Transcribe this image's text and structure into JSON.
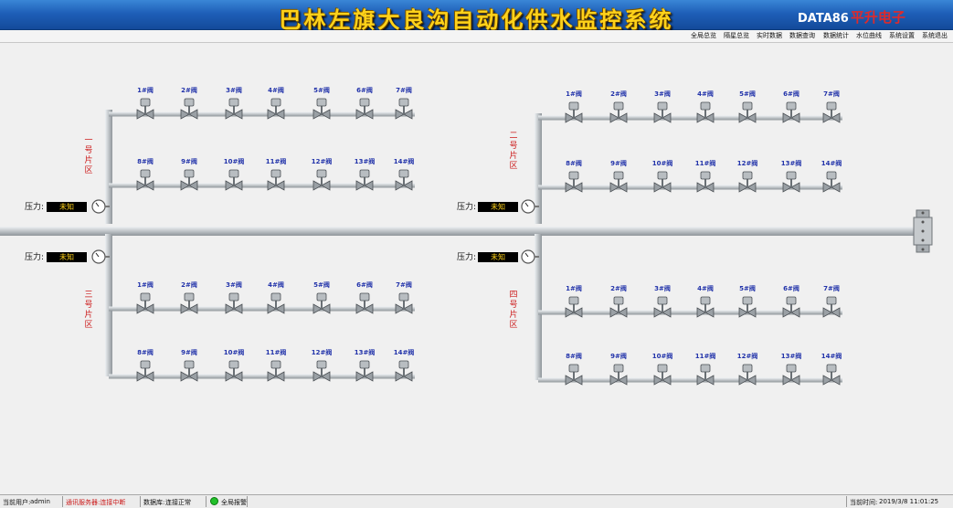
{
  "app": {
    "title": "巴林左旗大良沟自动化供水监控系统",
    "brand_primary": "DATA86",
    "brand_secondary": "平升电子"
  },
  "menu": [
    {
      "label": "全局总览"
    },
    {
      "label": "隔星总览"
    },
    {
      "label": "实时数据"
    },
    {
      "label": "数据查询"
    },
    {
      "label": "数据统计"
    },
    {
      "label": "水位曲线"
    },
    {
      "label": "系统设置"
    },
    {
      "label": "系统退出"
    }
  ],
  "zones": [
    {
      "label": "一号片区",
      "pressure_label": "压力:",
      "pressure_value": "未知",
      "row1": [
        "1#阀",
        "2#阀",
        "3#阀",
        "4#阀",
        "5#阀",
        "6#阀",
        "7#阀"
      ],
      "row2": [
        "8#阀",
        "9#阀",
        "10#阀",
        "11#阀",
        "12#阀",
        "13#阀",
        "14#阀"
      ]
    },
    {
      "label": "二号片区",
      "pressure_label": "压力:",
      "pressure_value": "未知",
      "row1": [
        "1#阀",
        "2#阀",
        "3#阀",
        "4#阀",
        "5#阀",
        "6#阀",
        "7#阀"
      ],
      "row2": [
        "8#阀",
        "9#阀",
        "10#阀",
        "11#阀",
        "12#阀",
        "13#阀",
        "14#阀"
      ]
    },
    {
      "label": "三号片区",
      "pressure_label": "压力:",
      "pressure_value": "未知",
      "row1": [
        "1#阀",
        "2#阀",
        "3#阀",
        "4#阀",
        "5#阀",
        "6#阀",
        "7#阀"
      ],
      "row2": [
        "8#阀",
        "9#阀",
        "10#阀",
        "11#阀",
        "12#阀",
        "13#阀",
        "14#阀"
      ]
    },
    {
      "label": "四号片区",
      "pressure_label": "压力:",
      "pressure_value": "未知",
      "row1": [
        "1#阀",
        "2#阀",
        "3#阀",
        "4#阀",
        "5#阀",
        "6#阀",
        "7#阀"
      ],
      "row2": [
        "8#阀",
        "9#阀",
        "10#阀",
        "11#阀",
        "12#阀",
        "13#阀",
        "14#阀"
      ]
    }
  ],
  "status": {
    "user_label": "当前用户:",
    "user_value": "admin",
    "comm_status": "通讯服务器:连接中断",
    "db_label": "数据库:",
    "db_value": "连接正常",
    "alarm_label": "全局报警",
    "time_label": "当前时间:",
    "time_value": "2019/3/8 11:01:25"
  },
  "colors": {
    "title_bar": "#1e5fb8",
    "title_text": "#ffd21a",
    "comm_error": "#cc1a1a",
    "alarm_ok": "#22c02a",
    "pipe": "#cfd3d6"
  }
}
